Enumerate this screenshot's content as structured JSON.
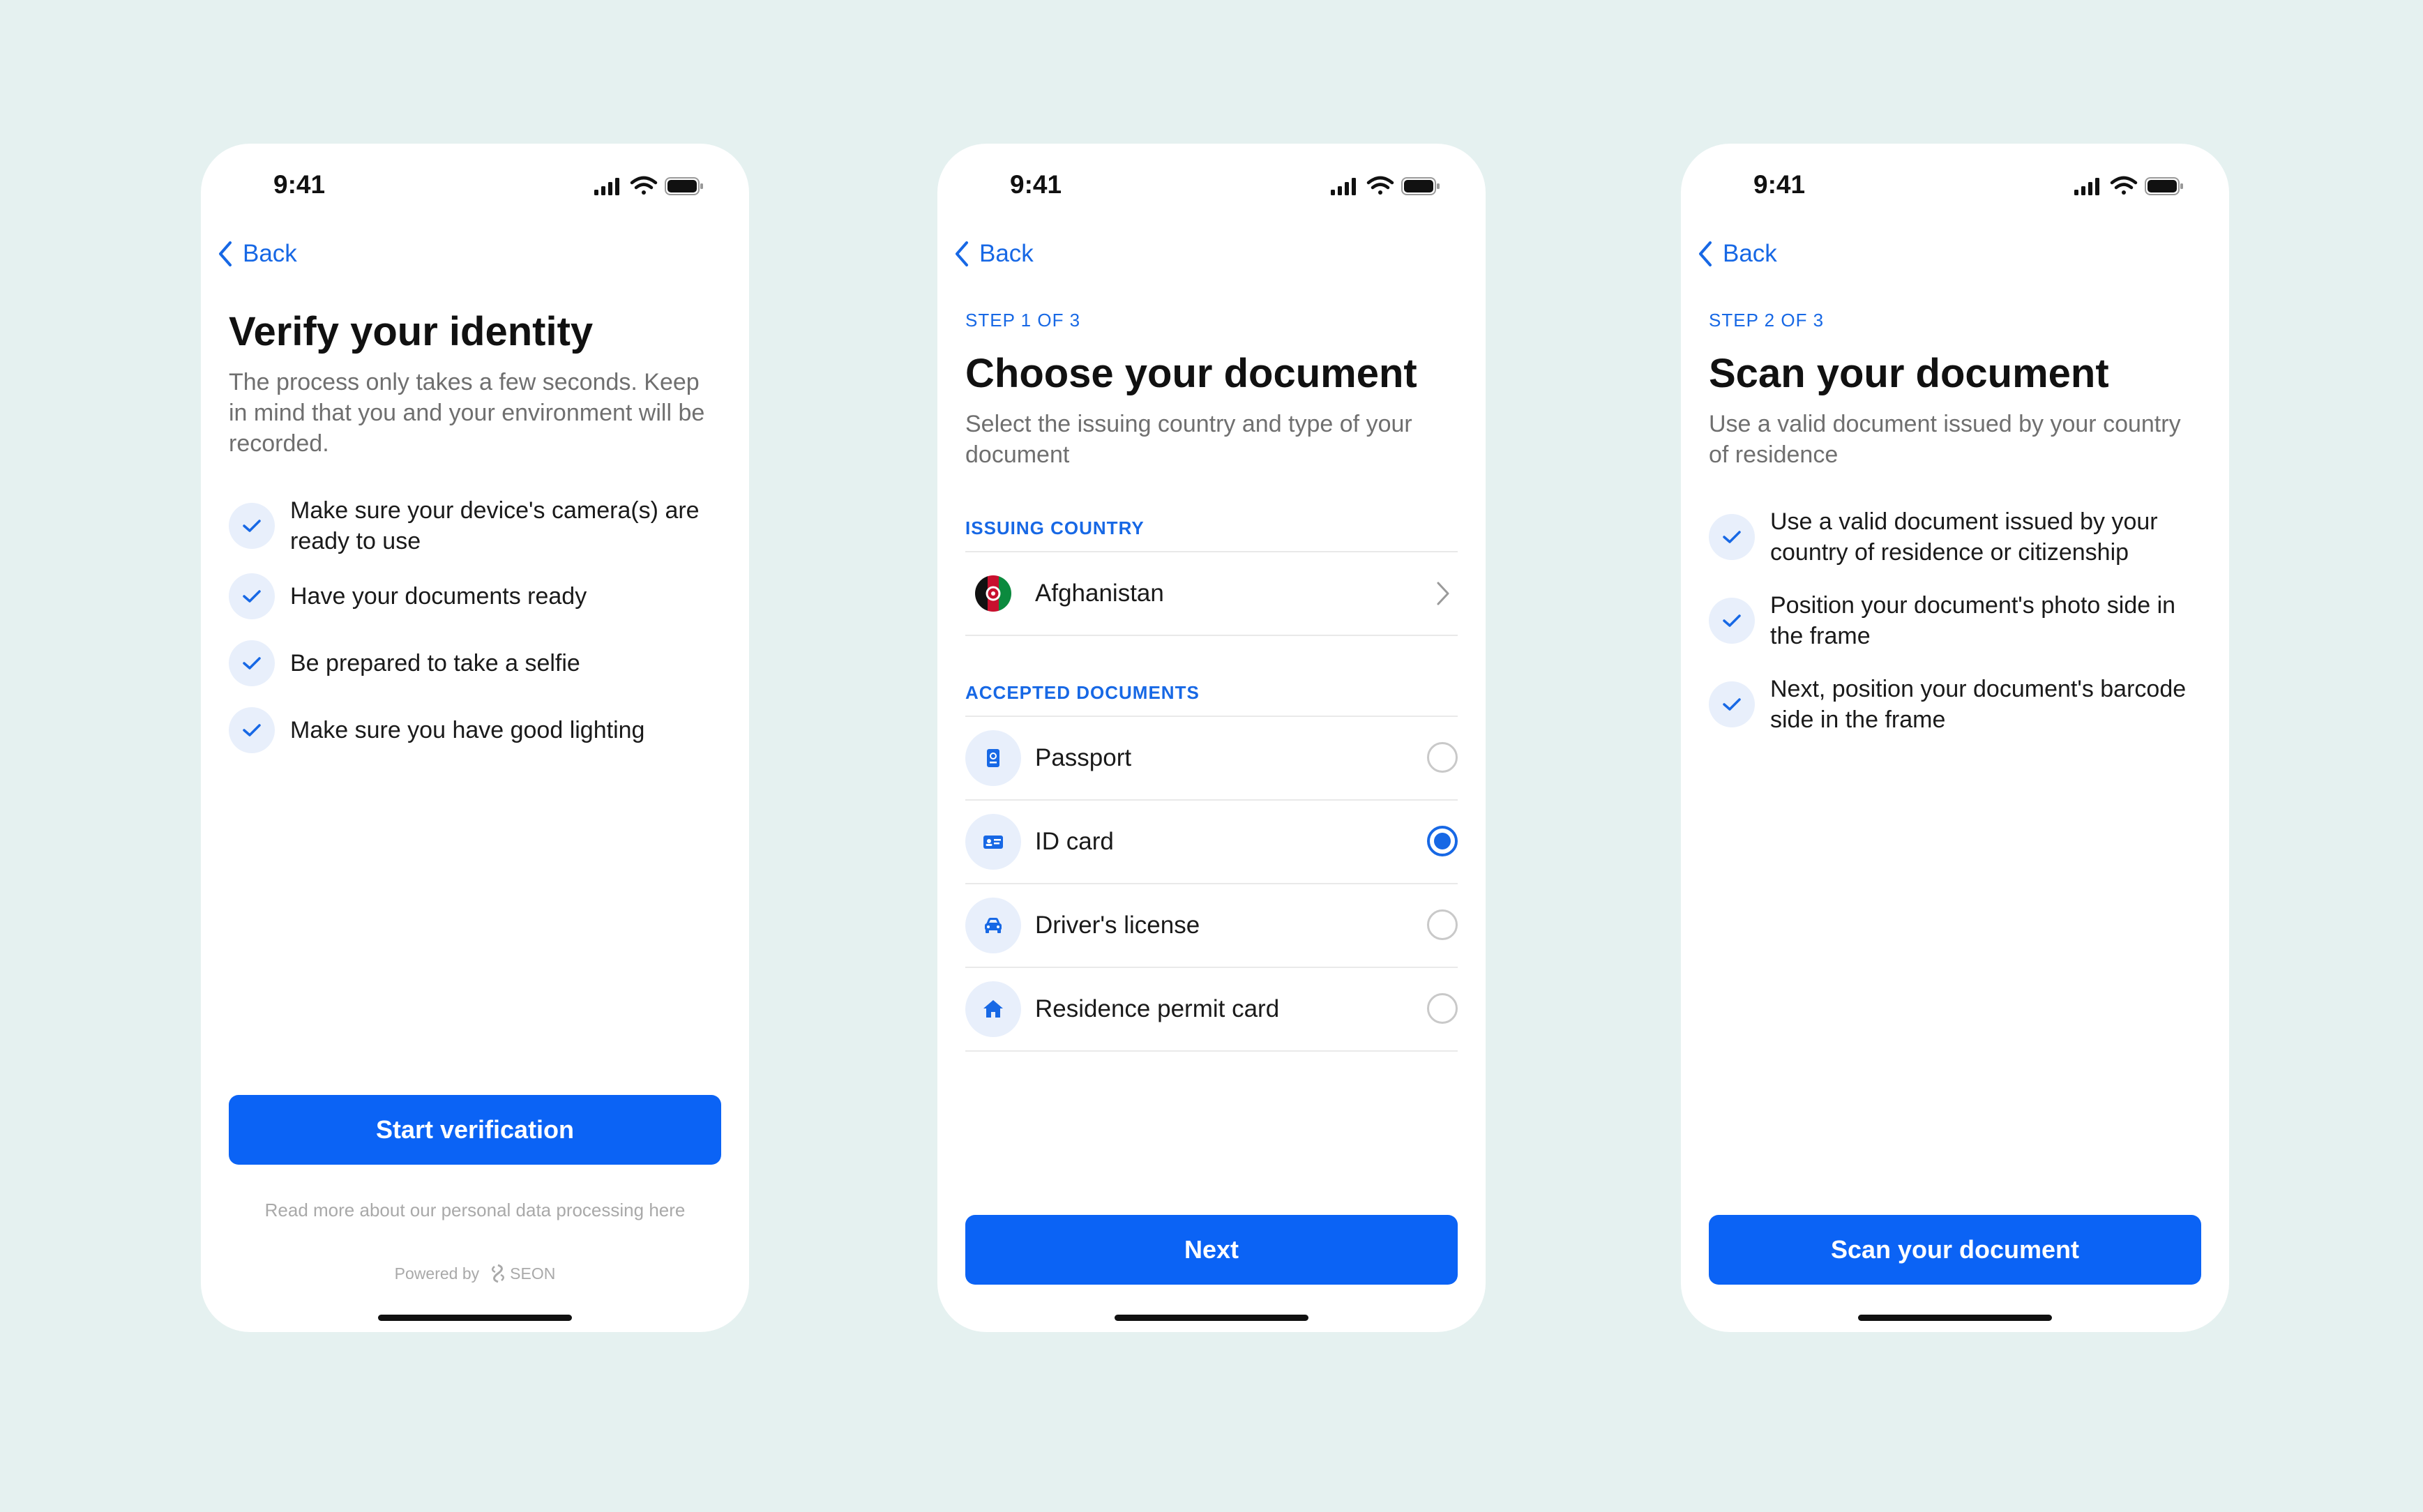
{
  "colors": {
    "background": "#e5f1f0",
    "accent": "#0b63f5",
    "link": "#1768e5",
    "muted": "#6f6f6f"
  },
  "screens": [
    {
      "status_time": "9:41",
      "back_label": "Back",
      "title": "Verify your identity",
      "subtitle": "The process only takes a few seconds. Keep in mind that you and your environment will be recorded.",
      "checklist": [
        "Make sure your device's camera(s) are ready to use",
        "Have your documents ready",
        "Be prepared to take a selfie",
        "Make sure you have good lighting"
      ],
      "button_label": "Start verification",
      "footer_link": "Read more about our personal data processing here",
      "powered_by": "Powered by",
      "brand": "SEON"
    },
    {
      "status_time": "9:41",
      "back_label": "Back",
      "step": "STEP 1 OF 3",
      "title": "Choose your document",
      "subtitle": "Select the issuing country and type of your document",
      "country_section_label": "ISSUING COUNTRY",
      "country": "Afghanistan",
      "documents_section_label": "ACCEPTED DOCUMENTS",
      "documents": [
        {
          "label": "Passport",
          "icon": "passport-icon",
          "selected": false
        },
        {
          "label": "ID card",
          "icon": "id-card-icon",
          "selected": true
        },
        {
          "label": "Driver's license",
          "icon": "car-icon",
          "selected": false
        },
        {
          "label": "Residence permit card",
          "icon": "house-icon",
          "selected": false
        }
      ],
      "button_label": "Next"
    },
    {
      "status_time": "9:41",
      "back_label": "Back",
      "step": "STEP 2 OF 3",
      "title": "Scan your document",
      "subtitle": "Use a valid document issued by your country of residence",
      "checklist": [
        "Use a valid document issued by your country of residence or citizenship",
        "Position your document's photo side in the frame",
        "Next, position your document's barcode side in the frame"
      ],
      "button_label": "Scan your document"
    }
  ]
}
